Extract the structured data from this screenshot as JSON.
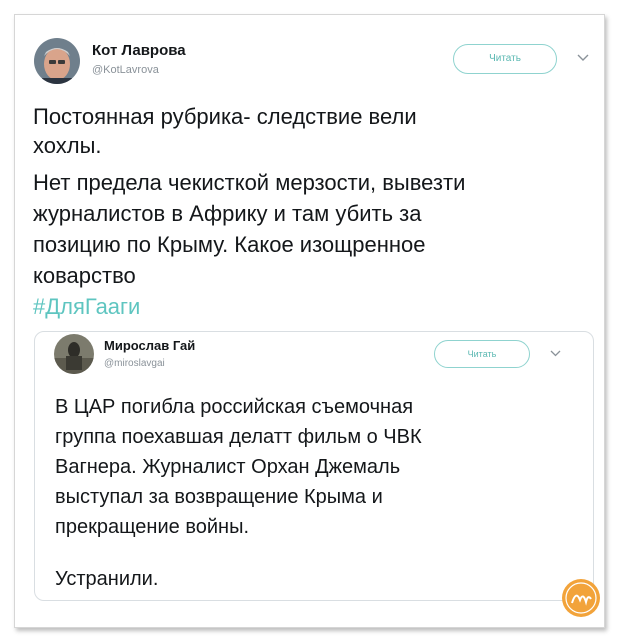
{
  "tweet": {
    "author_name": "Кот Лаврова",
    "author_handle": "@KotLavrova",
    "follow_label": "Читать",
    "text_lines": [
      "Постоянная рубрика- следствие вели",
      "хохлы.",
      "Нет предела чекисткой мерзости, вывезти",
      "журналистов в Африку и там убить за",
      "позицию по Крыму. Какое изощренное",
      "коварство"
    ],
    "hashtag": "#ДляГааги"
  },
  "quoted": {
    "author_name": "Мирослав Гай",
    "author_handle": "@miroslavgai",
    "follow_label": "Читать",
    "text_lines": [
      "В ЦАР погибла российская съемочная",
      "группа поехавшая делатт фильм о ЧВК",
      "Вагнера.  Журналист Орхан Джемаль",
      "выступал за возвращение Крыма и",
      "прекращение войны."
    ],
    "closing_line": "Устранили."
  },
  "colors": {
    "hashtag": "#5ec5c0",
    "follow_border": "#8fd3cf",
    "follow_text": "#5bb8b2",
    "badge": "#f2a33a"
  },
  "icons": {
    "chevron": "chevron-down-icon",
    "badge": "site-logo"
  }
}
